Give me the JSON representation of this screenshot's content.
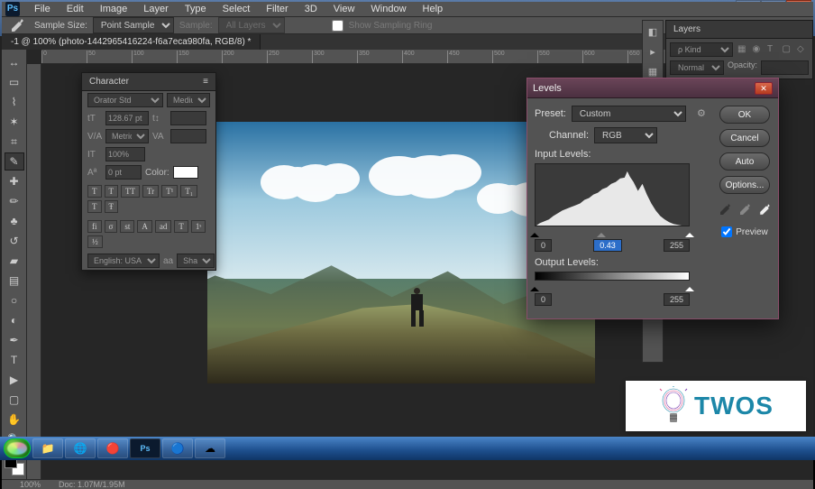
{
  "window": {
    "min": "—",
    "max": "☐",
    "close": "✕"
  },
  "menubar": {
    "logo": "Ps",
    "items": [
      "File",
      "Edit",
      "Image",
      "Layer",
      "Type",
      "Select",
      "Filter",
      "3D",
      "View",
      "Window",
      "Help"
    ]
  },
  "options": {
    "sample_size_label": "Sample Size:",
    "sample_size_value": "Point Sample",
    "sample_label": "Sample:",
    "sample_value": "All Layers",
    "show_ring": "Show Sampling Ring"
  },
  "doc_tab": "-1 @ 100% (photo-1442965416224-f6a7eca980fa, RGB/8) *",
  "ruler_marks": [
    "0",
    "50",
    "100",
    "150",
    "200",
    "250",
    "300",
    "350",
    "400",
    "450",
    "500",
    "550",
    "600",
    "650"
  ],
  "statusbar": {
    "zoom": "100%",
    "doc": "Doc: 1.07M/1.95M"
  },
  "tools": [
    {
      "name": "move-tool",
      "glyph": "↔"
    },
    {
      "name": "marquee-tool",
      "glyph": "▭"
    },
    {
      "name": "lasso-tool",
      "glyph": "⌇"
    },
    {
      "name": "quick-select-tool",
      "glyph": "✶"
    },
    {
      "name": "crop-tool",
      "glyph": "⌗"
    },
    {
      "name": "eyedropper-tool",
      "glyph": "✎",
      "active": true
    },
    {
      "name": "healing-brush-tool",
      "glyph": "✚"
    },
    {
      "name": "brush-tool",
      "glyph": "✏"
    },
    {
      "name": "clone-stamp-tool",
      "glyph": "♣"
    },
    {
      "name": "history-brush-tool",
      "glyph": "↺"
    },
    {
      "name": "eraser-tool",
      "glyph": "▰"
    },
    {
      "name": "gradient-tool",
      "glyph": "▤"
    },
    {
      "name": "blur-tool",
      "glyph": "○"
    },
    {
      "name": "dodge-tool",
      "glyph": "◐"
    },
    {
      "name": "pen-tool",
      "glyph": "✒"
    },
    {
      "name": "type-tool",
      "glyph": "T"
    },
    {
      "name": "path-select-tool",
      "glyph": "▶"
    },
    {
      "name": "rectangle-tool",
      "glyph": "▢"
    },
    {
      "name": "hand-tool",
      "glyph": "✋"
    },
    {
      "name": "zoom-tool",
      "glyph": "🔍"
    }
  ],
  "char_panel": {
    "title": "Character",
    "font": "Orator Std",
    "style": "Medium",
    "size_label": "tT",
    "size_value": "128.67 pt",
    "leading_label": "t↕",
    "leading_value": "",
    "kerning_label": "V/A",
    "kerning_value": "Metrics",
    "tracking_label": "VA",
    "tracking_value": "",
    "vscale_label": "IT",
    "vscale_value": "100%",
    "baseline_label": "Aª",
    "baseline_value": "0 pt",
    "color_label": "Color:",
    "style_btns": [
      "T",
      "T",
      "TT",
      "Tr",
      "T¹",
      "T₁",
      "T",
      "Ŧ"
    ],
    "ot_btns": [
      "fi",
      "σ",
      "st",
      "A",
      "ad",
      "T",
      "1ˢ",
      "½"
    ],
    "lang": "English: USA",
    "aa_label": "aa",
    "aa": "Sharp"
  },
  "layers": {
    "title": "Layers",
    "kind_label": "ρ Kind",
    "filters": [
      "▦",
      "◉",
      "T",
      "▢",
      "◇"
    ],
    "blend": "Normal",
    "opacity_label": "Opacity:",
    "opacity": ""
  },
  "levels": {
    "title": "Levels",
    "preset_label": "Preset:",
    "preset_value": "Custom",
    "channel_label": "Channel:",
    "channel_value": "RGB",
    "input_label": "Input Levels:",
    "in_black": "0",
    "in_gamma": "0.43",
    "in_white": "255",
    "output_label": "Output Levels:",
    "out_black": "0",
    "out_white": "255",
    "ok": "OK",
    "cancel": "Cancel",
    "auto": "Auto",
    "options": "Options...",
    "preview": "Preview"
  },
  "brand": "TWOS",
  "taskbar": {
    "icons": [
      {
        "name": "file-explorer",
        "glyph": "📁"
      },
      {
        "name": "internet-explorer",
        "glyph": "🌐"
      },
      {
        "name": "chrome",
        "glyph": "🔴"
      },
      {
        "name": "photoshop",
        "glyph": "Ps"
      },
      {
        "name": "teamviewer",
        "glyph": "🔵"
      },
      {
        "name": "creative-cloud",
        "glyph": "☁"
      }
    ]
  }
}
